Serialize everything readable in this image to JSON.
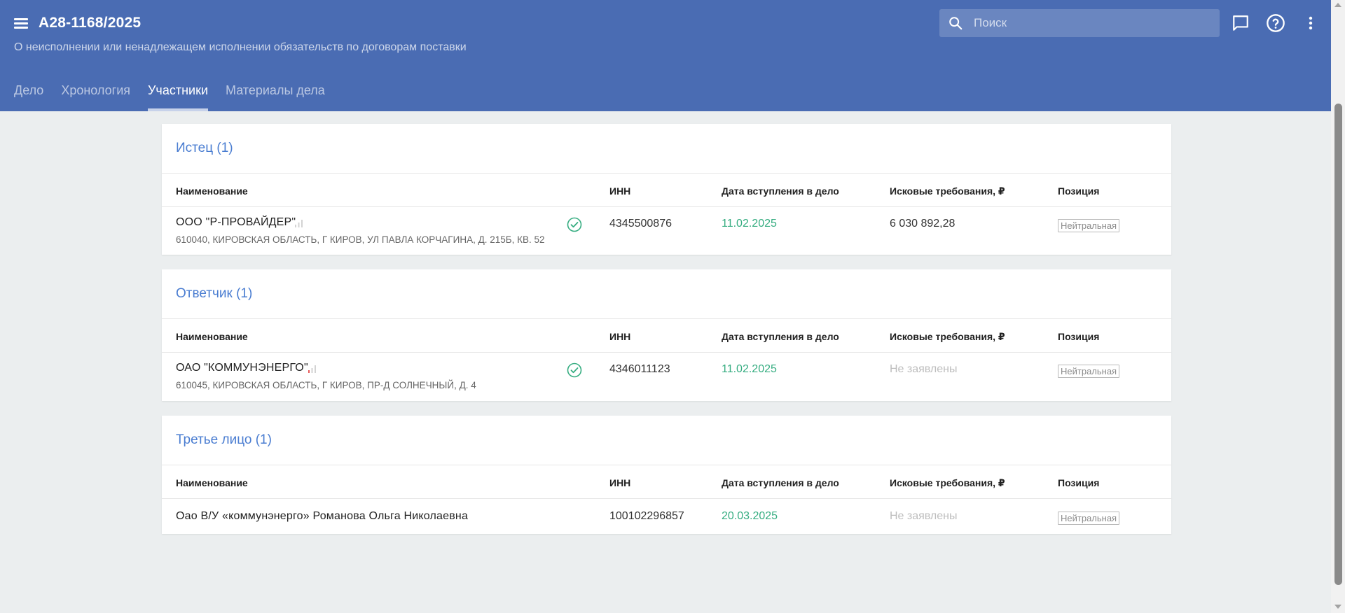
{
  "header": {
    "case_number": "А28-1168/2025",
    "subtitle": "О неисполнении или ненадлежащем исполнении обязательств по договорам поставки",
    "search_placeholder": "Поиск",
    "icons": [
      "menu-icon",
      "search-icon",
      "chat-icon",
      "help-icon",
      "more-vertical-icon"
    ]
  },
  "tabs": [
    {
      "label": "Дело",
      "active": false
    },
    {
      "label": "Хронология",
      "active": false
    },
    {
      "label": "Участники",
      "active": true
    },
    {
      "label": "Материалы дела",
      "active": false
    }
  ],
  "columns": {
    "name": "Наименование",
    "inn": "ИНН",
    "date": "Дата вступления в дело",
    "claims": "Исковые требования, ₽",
    "position": "Позиция"
  },
  "sections": [
    {
      "title": "Истец (1)",
      "rows": [
        {
          "name": "ООО \"Р-ПРОВАЙДЕР\"",
          "address": "610040, КИРОВСКАЯ ОБЛАСТЬ, Г КИРОВ, УЛ ПАВЛА КОРЧАГИНА, Д. 215Б, КВ. 52",
          "verified": true,
          "inn": "4345500876",
          "date": "11.02.2025",
          "claims": "6 030 892,28",
          "position": "Нейтральная"
        }
      ]
    },
    {
      "title": "Ответчик (1)",
      "rows": [
        {
          "name": "ОАО \"КОММУНЭНЕРГО\"",
          "address": "610045, КИРОВСКАЯ ОБЛАСТЬ, Г КИРОВ, ПР-Д СОЛНЕЧНЫЙ, Д. 4",
          "verified": true,
          "inn": "4346011123",
          "date": "11.02.2025",
          "claims": "Не заявлены",
          "position": "Нейтральная"
        }
      ]
    },
    {
      "title": "Третье лицо (1)",
      "rows": [
        {
          "name": "Оао В/У «коммунэнерго» Романова Ольга Николаевна",
          "inn": "100102296857",
          "date": "20.03.2025",
          "claims": "Не заявлены",
          "position": "Нейтральная"
        }
      ]
    }
  ],
  "colors": {
    "header_bg": "#4a6cb3",
    "accent_blue": "#4a7dd1",
    "date_green": "#36ad81",
    "page_bg": "#ebeeef"
  }
}
